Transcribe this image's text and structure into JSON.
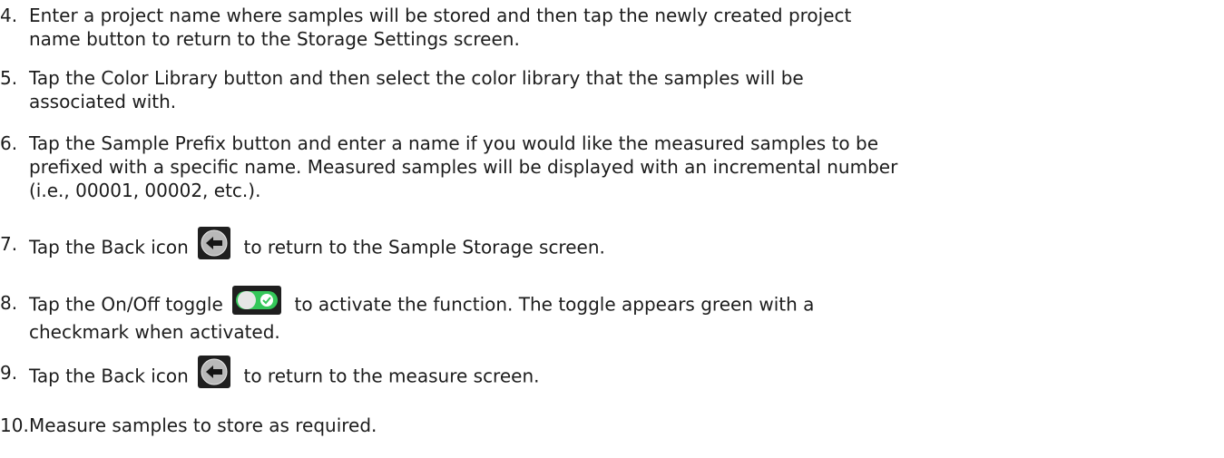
{
  "colors": {
    "text": "#1c1c1c",
    "back_icon_bg": "#1f1f1f",
    "back_icon_circle": "#b8b8b8",
    "toggle_bg": "#1f1f1f",
    "toggle_on": "#34c759",
    "toggle_knob": "#e6e6e6"
  },
  "icons": {
    "back": "back-arrow-circle-icon",
    "toggle": "on-off-toggle-icon"
  },
  "steps": [
    {
      "number": "4.",
      "lines": [
        "Enter a project name where samples will be stored and then tap the newly created project",
        "name button to return to the Storage Settings screen."
      ]
    },
    {
      "number": "5.",
      "lines": [
        "Tap the Color Library button and then select the color library that the samples will be",
        "associated with."
      ]
    },
    {
      "number": "6.",
      "lines": [
        "Tap the Sample Prefix button and enter a name if you would like the measured samples to be",
        "prefixed with a specific name. Measured samples will be displayed with an incremental number",
        "(i.e., 00001, 00002, etc.)."
      ]
    },
    {
      "number": "7.",
      "before": "Tap the Back icon",
      "after": "to return to the Sample Storage screen."
    },
    {
      "number": "8.",
      "before": "Tap the On/Off toggle",
      "after": "to activate the function. The toggle appears green with a",
      "line2": "checkmark when activated."
    },
    {
      "number": "9.",
      "before": "Tap the Back icon",
      "after": "to return to the measure screen."
    },
    {
      "number": "10.",
      "lines": [
        "Measure samples to store as required."
      ]
    }
  ]
}
